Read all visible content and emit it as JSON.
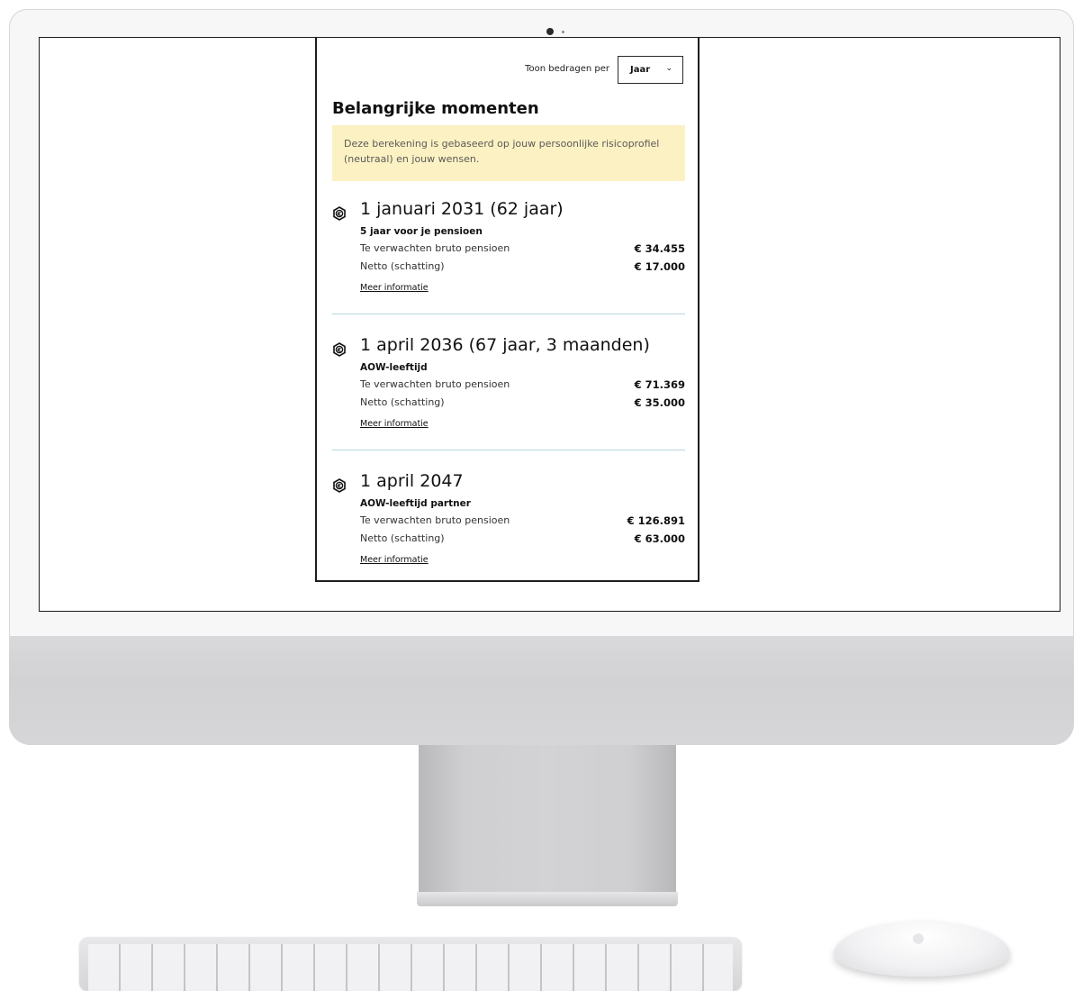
{
  "toolbar": {
    "label": "Toon bedragen per",
    "period": "Jaar",
    "options": [
      "Jaar"
    ]
  },
  "title": "Belangrijke momenten",
  "notice": "Deze berekening is gebaseerd op jouw persoonlijke risicoprofiel (neutraal) en jouw wensen.",
  "moments": [
    {
      "date": "1 januari 2031 (62 jaar)",
      "subtitle": "5 jaar voor je pensioen",
      "gross_label": "Te verwachten bruto pensioen",
      "gross_amount": "€ 34.455",
      "net_label": "Netto (schatting)",
      "net_amount": "€ 17.000",
      "link": "Meer informatie"
    },
    {
      "date": "1 april 2036 (67 jaar, 3 maanden)",
      "subtitle": "AOW-leeftijd",
      "gross_label": "Te verwachten bruto pensioen",
      "gross_amount": "€ 71.369",
      "net_label": "Netto (schatting)",
      "net_amount": "€ 35.000",
      "link": "Meer informatie"
    },
    {
      "date": "1 april 2047",
      "subtitle": "AOW-leeftijd partner",
      "gross_label": "Te verwachten bruto pensioen",
      "gross_amount": "€ 126.891",
      "net_label": "Netto (schatting)",
      "net_amount": "€ 63.000",
      "link": "Meer informatie"
    }
  ],
  "colors": {
    "notice_bg": "#fcf1c2",
    "divider": "#b8d6e6",
    "text": "#111111"
  },
  "icons": {
    "moment": "euro-coin-icon",
    "select": "chevron-down-icon"
  }
}
